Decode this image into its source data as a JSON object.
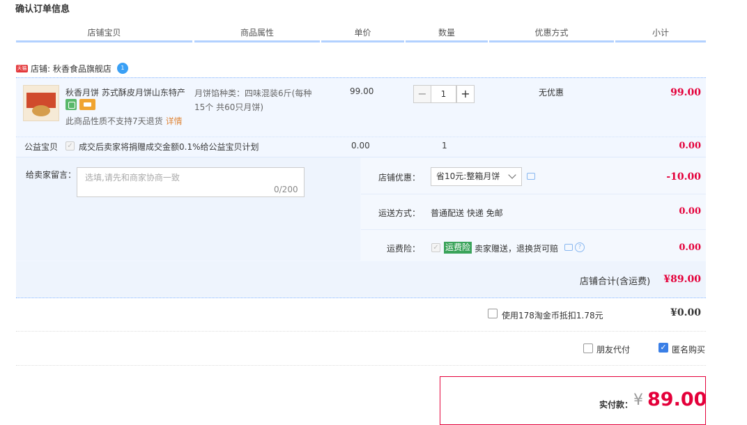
{
  "page": {
    "title": "确认订单信息"
  },
  "columns": [
    "店铺宝贝",
    "商品属性",
    "单价",
    "数量",
    "优惠方式",
    "小计"
  ],
  "shop": {
    "badge": "天猫",
    "label": "店铺: 秋香食品旗舰店",
    "wangwang": "1"
  },
  "item": {
    "name": "秋香月饼 苏式酥皮月饼山东特产",
    "props": "月饼馅种类：四味混装6斤(每种15个 共60只月饼)",
    "price": "99.00",
    "qty_minus": "−",
    "qty": "1",
    "qty_plus": "+",
    "discount": "无优惠",
    "subtotal": "99.00",
    "no_return": "此商品性质不支持7天退货",
    "detail_link": "详情"
  },
  "charity": {
    "label": "公益宝贝",
    "text": "成交后卖家将捐赠成交金额0.1%给公益宝贝计划",
    "price": "0.00",
    "qty": "1",
    "subtotal": "0.00"
  },
  "message": {
    "label": "给卖家留言：",
    "placeholder": "选填,请先和商家协商一致",
    "count": "0/200"
  },
  "coupon": {
    "label": "店铺优惠：",
    "selected": "省10元:整箱月饼",
    "amount": "-10.00"
  },
  "shipping": {
    "label": "运送方式：",
    "value": "普通配送 快递 免邮",
    "amount": "0.00"
  },
  "insurance": {
    "label": "运费险：",
    "badge": "运费险",
    "text": "卖家赠送，退换货可赔",
    "help": "?",
    "amount": "0.00"
  },
  "shop_total": {
    "label": "店铺合计(含运费)",
    "amount": "¥89.00"
  },
  "coins": {
    "text": "使用178淘金币抵扣1.78元",
    "amount": "¥0.00",
    "checked": false
  },
  "options": {
    "friend_pay": "朋友代付",
    "anonymous": "匿名购买",
    "anonymous_checked": true
  },
  "payment": {
    "label": "实付款：",
    "currency": "¥",
    "amount": "89.00"
  }
}
